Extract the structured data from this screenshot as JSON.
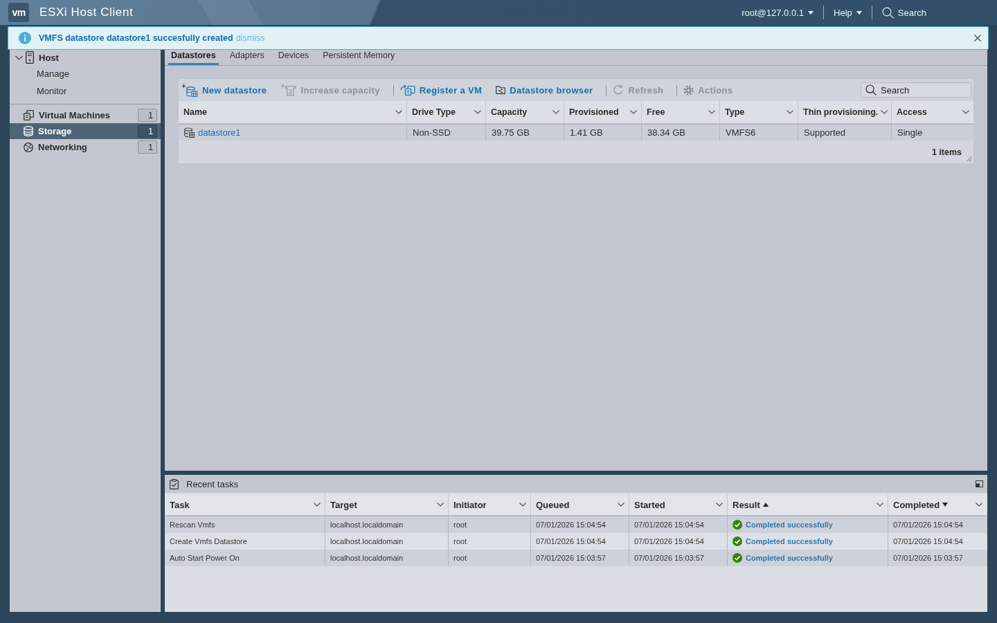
{
  "header": {
    "logo": "vm",
    "title": "ESXi Host Client",
    "menus": [
      {
        "label": "root@127.0.0.1"
      },
      {
        "label": "Help"
      }
    ],
    "search": {
      "label": "Search"
    }
  },
  "banner": {
    "message": "VMFS datastore datastore1 succesfully created",
    "link": "dismiss"
  },
  "sidebar": {
    "items": [
      {
        "label": "Host",
        "expanded": true,
        "selected": false,
        "children": [
          {
            "label": "Manage",
            "selected": false
          },
          {
            "label": "Monitor",
            "selected": false
          }
        ]
      },
      {
        "label": "Virtual Machines",
        "badge": "1",
        "selected": false
      },
      {
        "label": "Storage",
        "badge": "1",
        "selected": true
      },
      {
        "label": "Networking",
        "badge": "1",
        "selected": false
      }
    ]
  },
  "tabs": [
    {
      "label": "Datastores",
      "selected": true
    },
    {
      "label": "Adapters",
      "selected": false
    },
    {
      "label": "Devices",
      "selected": false
    },
    {
      "label": "Persistent Memory",
      "selected": false
    }
  ],
  "datastores": {
    "toolbar": [
      {
        "kind": "button",
        "label": "New datastore",
        "disabled": false
      },
      {
        "kind": "button",
        "label": "Increase capacity",
        "disabled": true
      },
      {
        "kind": "separator"
      },
      {
        "kind": "button",
        "label": "Register a VM",
        "disabled": false
      },
      {
        "kind": "button",
        "label": "Datastore browser",
        "disabled": false
      },
      {
        "kind": "separator"
      },
      {
        "kind": "button",
        "label": "Refresh",
        "disabled": true
      },
      {
        "kind": "separator"
      },
      {
        "kind": "button",
        "label": "Actions",
        "disabled": true
      }
    ],
    "search": {
      "placeholder": "Search"
    },
    "columns": [
      "Name",
      "Drive Type",
      "Capacity",
      "Provisioned",
      "Free",
      "Type",
      "Thin provisioning.",
      "Access"
    ],
    "rows": [
      {
        "cells": [
          "datastore1",
          "Non-SSD",
          "39.75 GB",
          "1.41 GB",
          "38.34 GB",
          "VMFS6",
          "Supported",
          "Single"
        ]
      }
    ],
    "footer": "1 items"
  },
  "recent_tasks": {
    "title": "Recent tasks",
    "columns": [
      {
        "label": "Task",
        "sort_ascending": false,
        "sort_descending": false
      },
      {
        "label": "Target",
        "sort_ascending": false,
        "sort_descending": false
      },
      {
        "label": "Initiator",
        "sort_ascending": false,
        "sort_descending": false
      },
      {
        "label": "Queued",
        "sort_ascending": false,
        "sort_descending": false
      },
      {
        "label": "Started",
        "sort_ascending": false,
        "sort_descending": false
      },
      {
        "label": "Result",
        "sort_ascending": true,
        "sort_descending": false
      },
      {
        "label": "Completed",
        "sort_ascending": false,
        "sort_descending": true
      }
    ],
    "rows": [
      {
        "task": "Rescan Vmfs",
        "target": "localhost.localdomain",
        "initiator": "root",
        "queued": "07/01/2026 15:04:54",
        "started": "07/01/2026 15:04:54",
        "result": {
          "success": true,
          "text": "Completed successfully"
        },
        "completed": "07/01/2026 15:04:54"
      },
      {
        "task": "Create Vmfs Datastore",
        "target": "localhost.localdomain",
        "initiator": "root",
        "queued": "07/01/2026 15:04:54",
        "started": "07/01/2026 15:04:54",
        "result": {
          "success": true,
          "text": "Completed successfully"
        },
        "completed": "07/01/2026 15:04:54"
      },
      {
        "task": "Auto Start Power On",
        "target": "localhost.localdomain",
        "initiator": "root",
        "queued": "07/01/2026 15:03:57",
        "started": "07/01/2026 15:03:57",
        "result": {
          "success": true,
          "text": "Completed successfully"
        },
        "completed": "07/01/2026 15:03:57"
      }
    ]
  }
}
